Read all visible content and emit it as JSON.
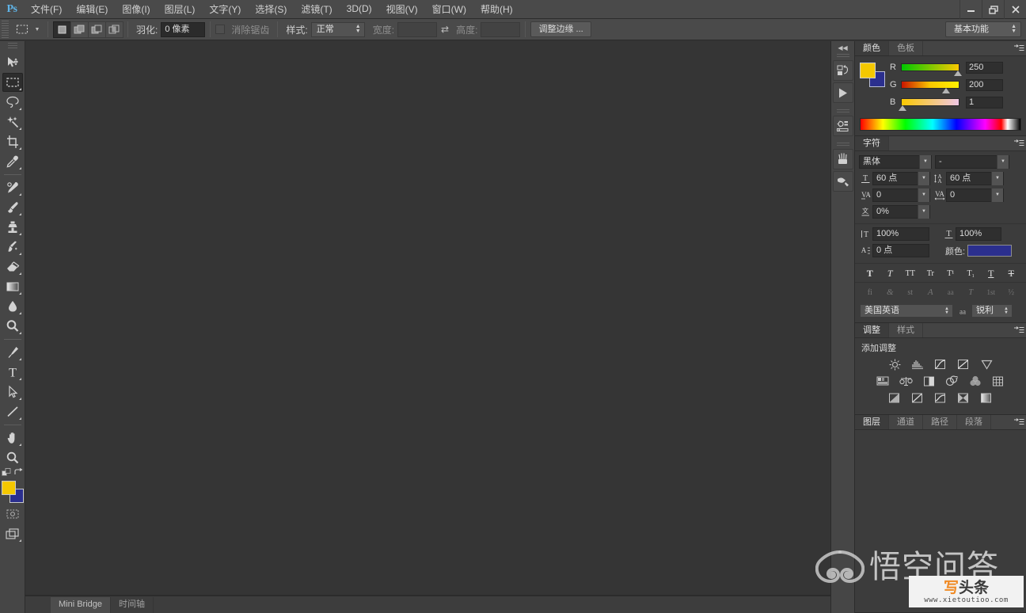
{
  "app": {
    "logo": "Ps",
    "workspace": "基本功能"
  },
  "menubar": {
    "items": [
      {
        "label": "文件(F)"
      },
      {
        "label": "编辑(E)"
      },
      {
        "label": "图像(I)"
      },
      {
        "label": "图层(L)"
      },
      {
        "label": "文字(Y)"
      },
      {
        "label": "选择(S)"
      },
      {
        "label": "滤镜(T)"
      },
      {
        "label": "3D(D)"
      },
      {
        "label": "视图(V)"
      },
      {
        "label": "窗口(W)"
      },
      {
        "label": "帮助(H)"
      }
    ],
    "window_controls": {
      "minimize": "minimize-icon",
      "restore": "restore-icon",
      "close": "close-icon"
    }
  },
  "optionsbar": {
    "tool_icon": "rectangular-marquee-icon",
    "bool_buttons": [
      {
        "name": "new-selection",
        "active": true
      },
      {
        "name": "add-to-selection",
        "active": false
      },
      {
        "name": "subtract-from-selection",
        "active": false
      },
      {
        "name": "intersect-selection",
        "active": false
      }
    ],
    "feather_label": "羽化:",
    "feather_value": "0 像素",
    "antialias_label": "消除锯齿",
    "antialias_checked": false,
    "style_label": "样式:",
    "style_value": "正常",
    "width_label": "宽度:",
    "width_value": "",
    "height_label": "高度:",
    "height_value": "",
    "refine_edge_label": "调整边缘 ..."
  },
  "toolbar": {
    "tools": [
      {
        "name": "move-tool",
        "selected": false,
        "has_flyout": false
      },
      {
        "name": "rectangular-marquee-tool",
        "selected": true,
        "has_flyout": true
      },
      {
        "name": "lasso-tool",
        "selected": false,
        "has_flyout": true
      },
      {
        "name": "quick-selection-tool",
        "selected": false,
        "has_flyout": true
      },
      {
        "name": "crop-tool",
        "selected": false,
        "has_flyout": true
      },
      {
        "name": "eyedropper-tool",
        "selected": false,
        "has_flyout": true
      },
      {
        "name": "spot-healing-brush-tool",
        "selected": false,
        "has_flyout": true
      },
      {
        "name": "brush-tool",
        "selected": false,
        "has_flyout": true
      },
      {
        "name": "clone-stamp-tool",
        "selected": false,
        "has_flyout": true
      },
      {
        "name": "history-brush-tool",
        "selected": false,
        "has_flyout": true
      },
      {
        "name": "eraser-tool",
        "selected": false,
        "has_flyout": true
      },
      {
        "name": "gradient-tool",
        "selected": false,
        "has_flyout": true
      },
      {
        "name": "blur-tool",
        "selected": false,
        "has_flyout": true
      },
      {
        "name": "dodge-tool",
        "selected": false,
        "has_flyout": true
      },
      {
        "name": "pen-tool",
        "selected": false,
        "has_flyout": true
      },
      {
        "name": "horizontal-type-tool",
        "selected": false,
        "has_flyout": true
      },
      {
        "name": "path-selection-tool",
        "selected": false,
        "has_flyout": true
      },
      {
        "name": "line-shape-tool",
        "selected": false,
        "has_flyout": true
      },
      {
        "name": "hand-tool",
        "selected": false,
        "has_flyout": true
      },
      {
        "name": "zoom-tool",
        "selected": false,
        "has_flyout": false
      }
    ],
    "foreground_color": "#f5c800",
    "background_color": "#2b2f8e"
  },
  "dockstrip": {
    "icons": [
      {
        "name": "history-panel-icon"
      },
      {
        "name": "actions-panel-icon"
      },
      {
        "name": "adjustments-panel-icon"
      },
      {
        "name": "brush-panel-icon"
      },
      {
        "name": "clone-source-panel-icon"
      }
    ]
  },
  "color_panel": {
    "tabs": [
      {
        "label": "颜色",
        "active": true
      },
      {
        "label": "色板",
        "active": false
      }
    ],
    "foreground_color": "#f5c800",
    "background_color": "#2b2f8e",
    "channels": [
      {
        "label": "R",
        "value": "250",
        "percent": 98
      },
      {
        "label": "G",
        "value": "200",
        "percent": 78
      },
      {
        "label": "B",
        "value": "1",
        "percent": 0
      }
    ]
  },
  "character_panel": {
    "tabs": [
      {
        "label": "字符",
        "active": true
      }
    ],
    "font_family": "黑体",
    "font_style": "-",
    "font_size": "60 点",
    "leading": "60 点",
    "kerning": "0",
    "tracking": "0",
    "baseline_shift_pct": "0%",
    "vertical_scale": "100%",
    "horizontal_scale": "100%",
    "baseline_shift": "0 点",
    "color_label": "颜色:",
    "text_color": "#2b2f8e",
    "style_buttons": [
      {
        "name": "faux-bold",
        "glyph": "T"
      },
      {
        "name": "faux-italic",
        "glyph": "T"
      },
      {
        "name": "all-caps",
        "glyph": "TT"
      },
      {
        "name": "small-caps",
        "glyph": "Tr"
      },
      {
        "name": "superscript",
        "glyph": "T¹"
      },
      {
        "name": "subscript",
        "glyph": "T₁"
      },
      {
        "name": "underline",
        "glyph": "T"
      },
      {
        "name": "strikethrough",
        "glyph": "T"
      }
    ],
    "opentype_buttons": [
      {
        "name": "standard-ligatures",
        "glyph": "fi"
      },
      {
        "name": "contextual-alternates",
        "glyph": "&"
      },
      {
        "name": "discretionary-ligatures",
        "glyph": "st"
      },
      {
        "name": "swash",
        "glyph": "A"
      },
      {
        "name": "oldstyle",
        "glyph": "aa"
      },
      {
        "name": "titling-alternates",
        "glyph": "T"
      },
      {
        "name": "ordinals",
        "glyph": "1st"
      },
      {
        "name": "fractions",
        "glyph": "½"
      }
    ],
    "language": "美国英语",
    "antialias_icon": "aa-icon",
    "antialias_method": "锐利"
  },
  "adjustments_panel": {
    "tabs": [
      {
        "label": "调整",
        "active": true
      },
      {
        "label": "样式",
        "active": false
      }
    ],
    "title": "添加调整",
    "rows": [
      [
        {
          "name": "brightness-contrast-icon"
        },
        {
          "name": "levels-icon"
        },
        {
          "name": "curves-icon"
        },
        {
          "name": "exposure-icon"
        },
        {
          "name": "vibrance-icon"
        }
      ],
      [
        {
          "name": "hue-saturation-icon"
        },
        {
          "name": "color-balance-icon"
        },
        {
          "name": "black-white-icon"
        },
        {
          "name": "photo-filter-icon"
        },
        {
          "name": "channel-mixer-icon"
        },
        {
          "name": "color-lookup-icon"
        }
      ],
      [
        {
          "name": "invert-icon"
        },
        {
          "name": "posterize-icon"
        },
        {
          "name": "threshold-icon"
        },
        {
          "name": "selective-color-icon"
        },
        {
          "name": "gradient-map-icon"
        }
      ]
    ]
  },
  "layers_panel": {
    "tabs": [
      {
        "label": "图层",
        "active": true
      },
      {
        "label": "通道",
        "active": false
      },
      {
        "label": "路径",
        "active": false
      },
      {
        "label": "段落",
        "active": false
      }
    ]
  },
  "statusbar": {
    "tabs": [
      {
        "label": "Mini Bridge",
        "active": true
      },
      {
        "label": "时间轴",
        "active": false
      }
    ]
  },
  "watermark": {
    "logo_icon": "cloud-logo-icon",
    "text": "悟空问答",
    "badge_main_orange": "写",
    "badge_main_dark": "头条",
    "badge_url": "www.xietoutioo.com"
  }
}
